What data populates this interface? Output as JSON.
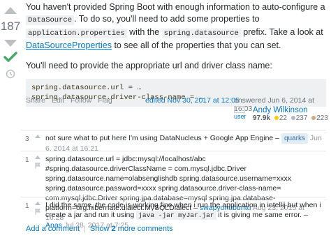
{
  "vote": {
    "count": "187"
  },
  "answer": {
    "p1_a": "You haven't provided Spring Boot with enough information to auto-configure a ",
    "p1_code1": "DataSource",
    "p1_b": ". To do so, you'll need to add some properties to ",
    "p1_code2": "application.properties",
    "p1_c": " with the ",
    "p1_code3": "spring.datasource",
    "p1_d": " prefix. Take a look at ",
    "p1_link": "DataSourceProperties",
    "p1_e": " to see all of the properties that you can set.",
    "p2": "You'll need to provide the appropriate url and driver class name:",
    "code_line1": "spring.datasource.url = …",
    "code_line2": "spring.datasource.driver-class-name = …"
  },
  "post_menu": {
    "share": "Share",
    "edit": "Edit",
    "follow": "Follow",
    "flag": "Flag"
  },
  "edited": "edited Nov 30, 2017 at 12:05",
  "answered": "answered Jun 6, 2014 at 16:03",
  "author": {
    "avatar_alt": "user",
    "name": "Andy Wilkinson",
    "reputation": "97.9k",
    "gold": "22",
    "silver": "237",
    "bronze": "223",
    "gold_color": "#ffcc01",
    "silver_color": "#b4b8bc",
    "bronze_color": "#d1a684"
  },
  "comments": [
    {
      "score": "3",
      "text": "not sure what to put here I'm using DataNucleus + Google App Engine –",
      "user": "quarks",
      "date": "Jun 6, 2014 at 16:21"
    },
    {
      "score": "1",
      "text": "spring.datasource.url = jdbc:mysql://localhost/abc #spring.datasource.driverClassName = com.mysql.jdbc.Driver spring.datasource.name=olabsenglishdb spring.datasource.username=xxxx spring.datasource.password=xxxx spring.datasource.driver-class-name= com.mysql.jdbc.Driver spring.jpa.database=mysql spring.jpa.database-platform=org.hibernate.dialect.MySQLDialect –",
      "user": "swapyonubuntu",
      "date": "Aug 23, 2015 at 16:28"
    },
    {
      "score": "1",
      "text_a": "I did the same, the code is working fine when i run the application in intellij but when i create a jar and run it using ",
      "code": "java -jar myJar.jar",
      "text_b": " it is giving me same error. –",
      "user": "Anas",
      "date": "Jul 28, 2017 at 7:25"
    }
  ],
  "comment_links": {
    "add": "Add a comment",
    "show_prefix": "Show ",
    "show_count": "2",
    "show_suffix": " more comments"
  }
}
